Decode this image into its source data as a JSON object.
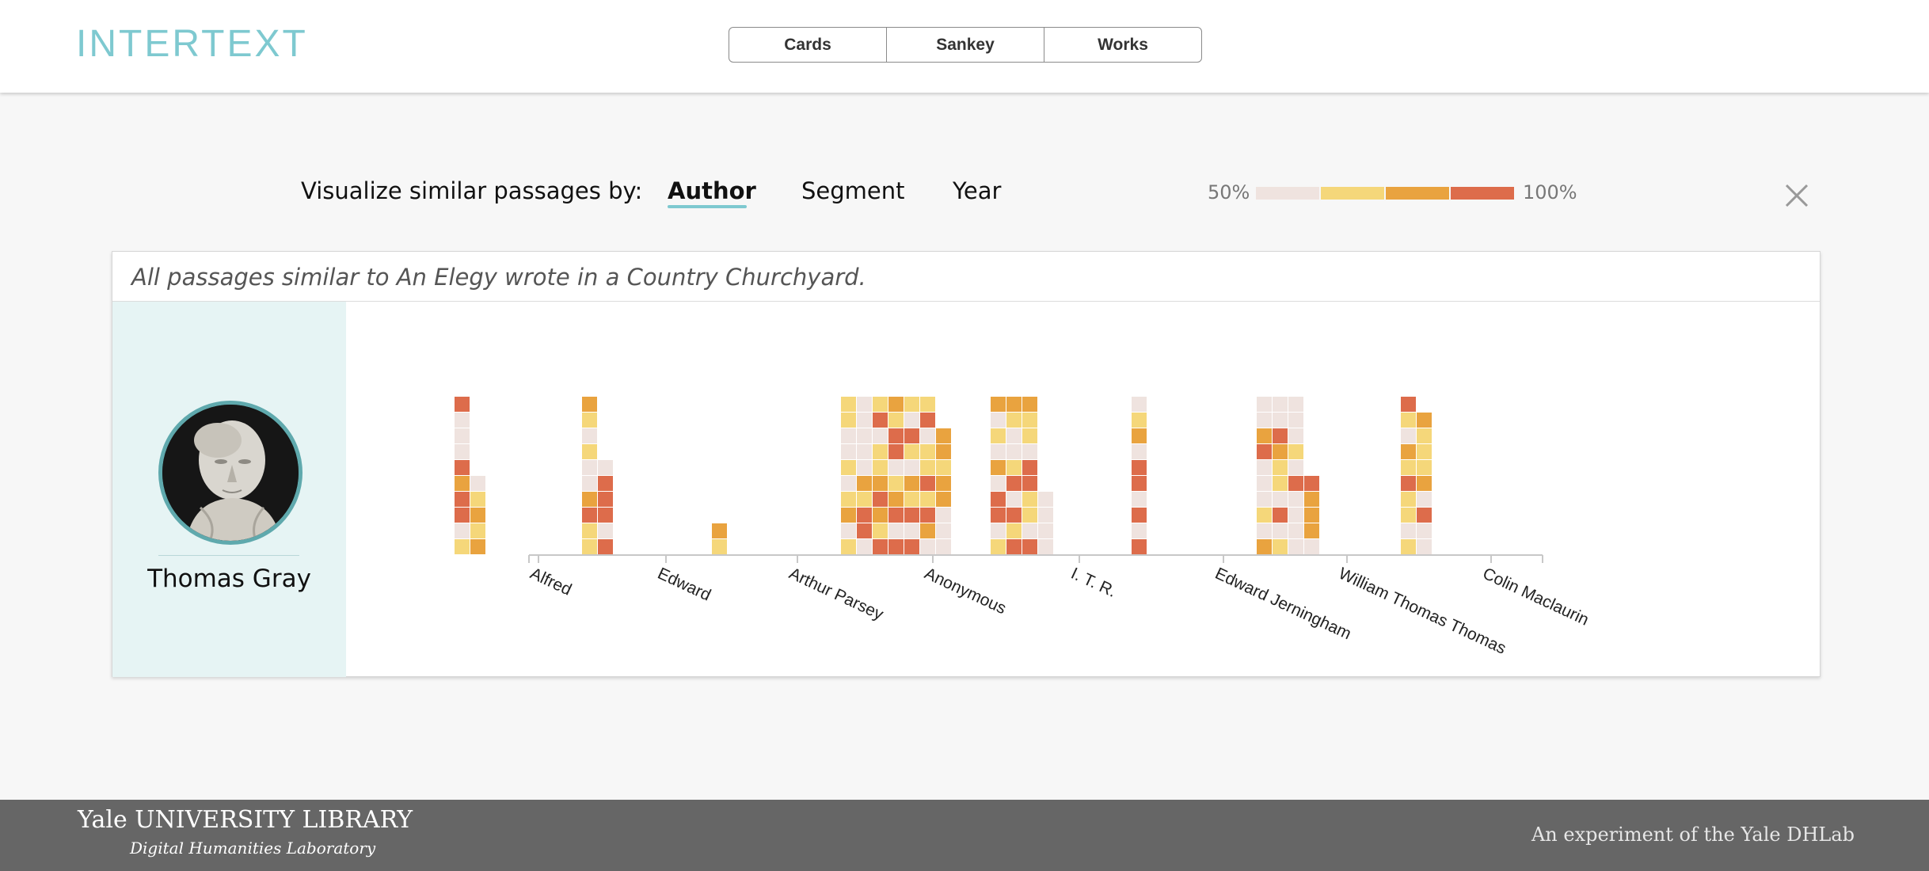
{
  "header": {
    "logo": "INTERTEXT",
    "nav": [
      "Cards",
      "Sankey",
      "Works"
    ]
  },
  "controls": {
    "label": "Visualize similar passages by:",
    "options": [
      "Author",
      "Segment",
      "Year"
    ],
    "active": "Author"
  },
  "legend": {
    "min_label": "50%",
    "max_label": "100%",
    "colors": [
      "#efe3df",
      "#f5d77a",
      "#e9a33f",
      "#dd6c4b"
    ]
  },
  "panel": {
    "title": "All passages similar to An Elegy wrote in a Country Churchyard.",
    "author_name": "Thomas Gray"
  },
  "footer": {
    "yale": "Yale UNIVERSITY LIBRARY",
    "yale_sub": "Digital Humanities Laboratory",
    "experiment": "An experiment of the Yale DHLab"
  },
  "chart_data": {
    "type": "heatmap",
    "title": "",
    "value_range": [
      "50%",
      "100%"
    ],
    "levels": [
      "50-62.5%",
      "62.5-75%",
      "75-87.5%",
      "87.5-100%"
    ],
    "categories": [
      "Alfred",
      "Edward",
      "Arthur Parsey",
      "Anonymous",
      "I. T. R.",
      "Edward Jerningham",
      "William Thomas Thomas",
      "Colin Maclaurin"
    ],
    "columns": [
      {
        "author": "Alfred",
        "stacks": [
          [
            1,
            0,
            3,
            3,
            2,
            3,
            0,
            0,
            0,
            3
          ],
          [
            2,
            1,
            2,
            1,
            0
          ]
        ]
      },
      {
        "author": "Edward",
        "stacks": [
          [
            1,
            1,
            3,
            2,
            0,
            0,
            1,
            0,
            1,
            2
          ],
          [
            3,
            0,
            3,
            3,
            3,
            0
          ]
        ]
      },
      {
        "author": "Arthur Parsey",
        "stacks": [
          [
            1,
            2
          ]
        ]
      },
      {
        "author": "Anonymous",
        "stacks": [
          [
            1,
            0,
            2,
            1,
            0,
            1,
            0,
            0,
            1,
            1
          ],
          [
            0,
            3,
            3,
            1,
            2,
            0,
            0,
            0,
            0,
            0
          ],
          [
            3,
            1,
            2,
            3,
            2,
            1,
            1,
            0,
            3,
            1
          ],
          [
            3,
            0,
            3,
            2,
            1,
            0,
            3,
            3,
            1,
            2
          ],
          [
            3,
            0,
            3,
            1,
            2,
            0,
            1,
            3,
            0,
            1
          ],
          [
            0,
            2,
            3,
            1,
            3,
            1,
            1,
            0,
            3,
            1
          ],
          [
            0,
            0,
            0,
            2,
            2,
            1,
            2,
            2
          ]
        ]
      },
      {
        "author": "I. T. R.",
        "stacks": [
          [
            1,
            0,
            3,
            3,
            0,
            2,
            0,
            1,
            0,
            2
          ],
          [
            3,
            1,
            3,
            0,
            3,
            1,
            0,
            0,
            1,
            2
          ],
          [
            3,
            0,
            1,
            1,
            3,
            3,
            0,
            1,
            1,
            2
          ],
          [
            0,
            0,
            0,
            0
          ]
        ]
      },
      {
        "author": "Edward Jerningham",
        "stacks": [
          [
            3,
            0,
            3,
            0,
            3,
            3,
            0,
            2,
            1,
            0
          ]
        ]
      },
      {
        "author": "William Thomas Thomas",
        "stacks": [
          [
            2,
            0,
            1,
            0,
            0,
            0,
            3,
            2,
            0,
            0
          ],
          [
            1,
            0,
            3,
            0,
            1,
            1,
            2,
            3,
            0,
            0
          ],
          [
            0,
            0,
            0,
            0,
            3,
            0,
            1,
            0,
            0,
            0
          ],
          [
            0,
            2,
            2,
            2,
            3
          ]
        ]
      },
      {
        "author": "Colin Maclaurin",
        "stacks": [
          [
            1,
            0,
            1,
            1,
            3,
            1,
            2,
            0,
            1,
            3
          ],
          [
            0,
            0,
            3,
            0,
            2,
            1,
            1,
            1,
            2
          ]
        ]
      }
    ]
  }
}
